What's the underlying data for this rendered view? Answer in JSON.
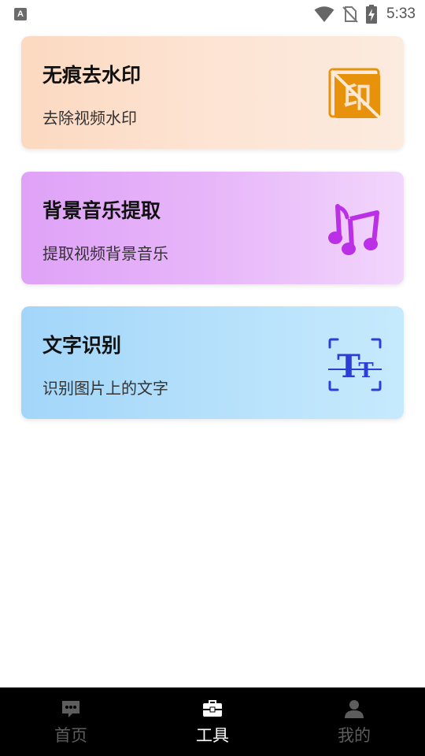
{
  "status_bar": {
    "notification_icon": "a-app-icon",
    "time": "5:33",
    "icons": [
      "wifi-icon",
      "no-sim-icon",
      "battery-charging-icon"
    ]
  },
  "cards": [
    {
      "title": "无痕去水印",
      "subtitle": "去除视频水印",
      "icon": "watermark-remove-icon",
      "icon_glyph": "印",
      "colors": {
        "from": "#fcd9c0",
        "to": "#fcebdf",
        "accent": "#e8910a"
      }
    },
    {
      "title": "背景音乐提取",
      "subtitle": "提取视频背景音乐",
      "icon": "music-note-icon",
      "colors": {
        "from": "#dfa2f7",
        "to": "#f2d6fc",
        "accent": "#bb2fe6"
      }
    },
    {
      "title": "文字识别",
      "subtitle": "识别图片上的文字",
      "icon": "text-scan-icon",
      "colors": {
        "from": "#a2d6f9",
        "to": "#c6eafd",
        "accent": "#2b3fd6"
      }
    }
  ],
  "bottom_nav": {
    "items": [
      {
        "label": "首页",
        "icon": "chat-home-icon",
        "active": false
      },
      {
        "label": "工具",
        "icon": "toolbox-icon",
        "active": true
      },
      {
        "label": "我的",
        "icon": "user-profile-icon",
        "active": false
      }
    ],
    "active_color": "#ffffff",
    "inactive_color": "#5d5d5d"
  }
}
